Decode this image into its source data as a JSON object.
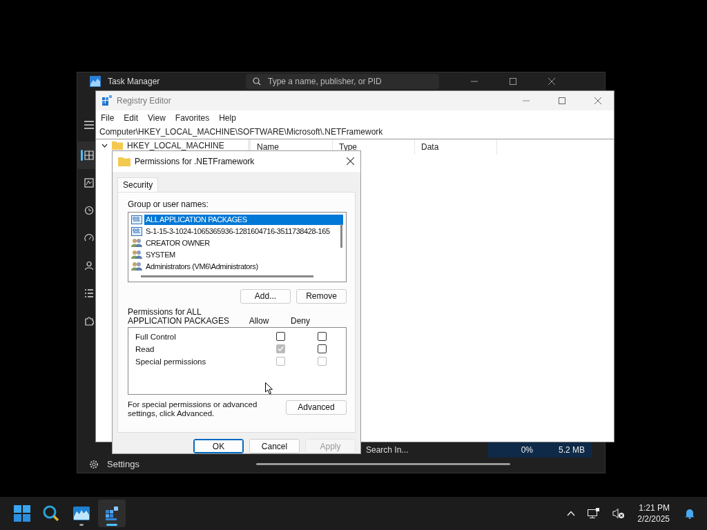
{
  "task_manager": {
    "title": "Task Manager",
    "search": {
      "placeholder": "Type a name, publisher, or PID"
    },
    "nav_items": [
      {
        "kind": "processes",
        "selected": true
      },
      {
        "kind": "performance",
        "selected": false
      },
      {
        "kind": "history",
        "selected": false
      },
      {
        "kind": "startup",
        "selected": false
      },
      {
        "kind": "users",
        "selected": false
      },
      {
        "kind": "details",
        "selected": false
      },
      {
        "kind": "services",
        "selected": false
      }
    ],
    "settings_label": "Settings",
    "row": {
      "name": "Search In...",
      "cpu": "0%",
      "memory": "5.2 MB"
    }
  },
  "registry_editor": {
    "title": "Registry Editor",
    "menu": [
      "File",
      "Edit",
      "View",
      "Favorites",
      "Help"
    ],
    "address": "Computer\\HKEY_LOCAL_MACHINE\\SOFTWARE\\Microsoft\\.NETFramework",
    "tree": [
      {
        "label": "HKEY_LOCAL_MACHINE",
        "expanded": true
      }
    ],
    "columns": [
      "Name",
      "Type",
      "Data"
    ]
  },
  "dialog": {
    "title": "Permissions for .NETFramework",
    "tabs": [
      {
        "label": "Security",
        "selected": true
      }
    ],
    "group_label": "Group or user names:",
    "principals": [
      {
        "name": "ALL APPLICATION PACKAGES",
        "kind": "package",
        "selected": true
      },
      {
        "name": "S-1-15-3-1024-1065365936-1281604716-3511738428-165",
        "kind": "package",
        "selected": false
      },
      {
        "name": "CREATOR OWNER",
        "kind": "group",
        "selected": false
      },
      {
        "name": "SYSTEM",
        "kind": "group",
        "selected": false
      },
      {
        "name": "Administrators (VM6\\Administrators)",
        "kind": "group",
        "selected": false
      }
    ],
    "add_button": "Add...",
    "remove_button": "Remove",
    "permissions_label": "Permissions for ALL APPLICATION PACKAGES",
    "allow_header": "Allow",
    "deny_header": "Deny",
    "permissions": [
      {
        "name": "Full Control",
        "allow": {
          "checked": false,
          "disabled": false
        },
        "deny": {
          "checked": false,
          "disabled": false
        }
      },
      {
        "name": "Read",
        "allow": {
          "checked": true,
          "disabled": true
        },
        "deny": {
          "checked": false,
          "disabled": false
        }
      },
      {
        "name": "Special permissions",
        "allow": {
          "checked": false,
          "disabled": true
        },
        "deny": {
          "checked": false,
          "disabled": true
        }
      }
    ],
    "advanced_text": "For special permissions or advanced settings, click Advanced.",
    "advanced_button": "Advanced",
    "buttons": [
      {
        "label": "OK",
        "kind": "default"
      },
      {
        "label": "Cancel",
        "kind": "normal"
      },
      {
        "label": "Apply",
        "kind": "disabled"
      }
    ]
  },
  "taskbar": {
    "apps": [
      {
        "kind": "search",
        "selected": false,
        "running": false
      },
      {
        "kind": "monitor",
        "selected": false,
        "running": true
      },
      {
        "kind": "registry",
        "selected": true,
        "running": true
      }
    ],
    "time": "1:21 PM",
    "date": "2/2/2025"
  }
}
